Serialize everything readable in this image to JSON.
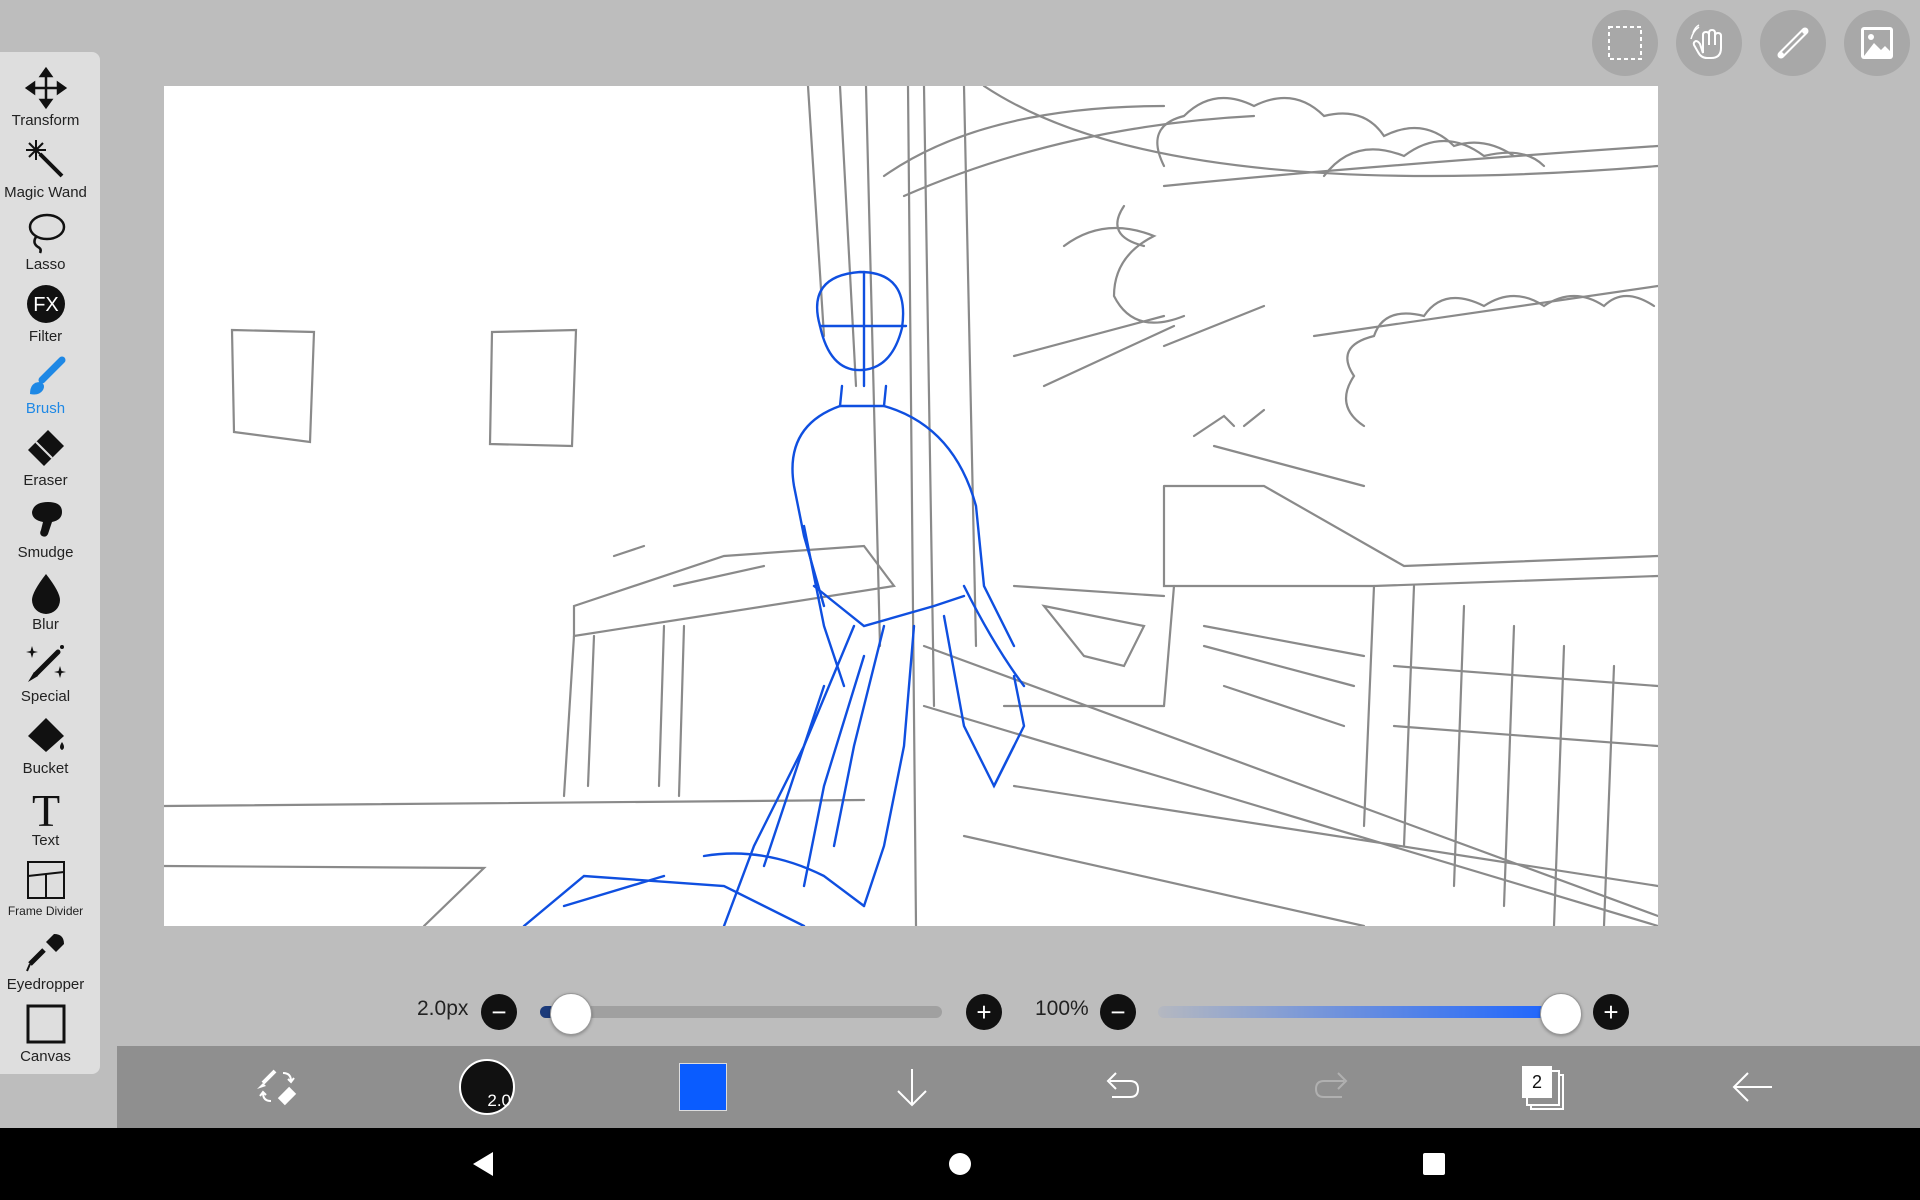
{
  "tools": [
    {
      "label": "Transform",
      "icon": "move-arrows-icon"
    },
    {
      "label": "Magic Wand",
      "icon": "magic-wand-icon"
    },
    {
      "label": "Lasso",
      "icon": "lasso-icon"
    },
    {
      "label": "Filter",
      "icon": "fx-icon",
      "glyph": "FX"
    },
    {
      "label": "Brush",
      "icon": "brush-icon",
      "active": true
    },
    {
      "label": "Eraser",
      "icon": "eraser-icon"
    },
    {
      "label": "Smudge",
      "icon": "smudge-icon"
    },
    {
      "label": "Blur",
      "icon": "droplet-icon"
    },
    {
      "label": "Special",
      "icon": "sparkle-brush-icon"
    },
    {
      "label": "Bucket",
      "icon": "bucket-icon"
    },
    {
      "label": "Text",
      "icon": "text-t-icon",
      "glyph": "T"
    },
    {
      "label": "Frame Divider",
      "icon": "frame-divider-icon"
    },
    {
      "label": "Eyedropper",
      "icon": "eyedropper-icon"
    },
    {
      "label": "Canvas",
      "icon": "canvas-icon"
    }
  ],
  "top_buttons": [
    "selection-icon",
    "hand-icon",
    "ruler-icon",
    "image-icon"
  ],
  "brush_size": {
    "label": "2.0px",
    "value_fraction": 0.05
  },
  "opacity": {
    "label": "100%",
    "value_fraction": 1.0
  },
  "bottom_bar": {
    "brush_size_badge": "2.0",
    "current_color": "#0a5cff",
    "layer_count": "2"
  },
  "colors": {
    "accent": "#1e88e5",
    "sketch_blue": "#0f4fe0",
    "sketch_gray": "#8a8a8a"
  }
}
